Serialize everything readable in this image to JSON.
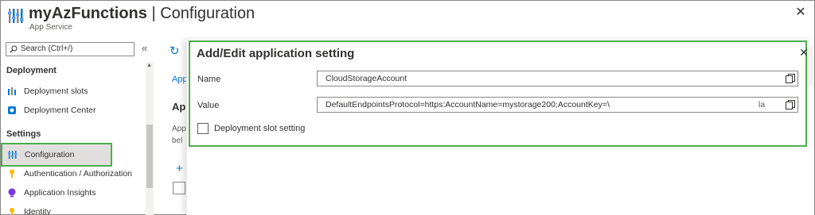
{
  "header": {
    "app_name": "myAzFunctions",
    "separator": " | ",
    "page_title": "Configuration",
    "subtitle": "App Service"
  },
  "sidebar": {
    "search_placeholder": "Search (Ctrl+/)",
    "collapse_glyph": "«",
    "sections": [
      {
        "label": "Deployment"
      },
      {
        "label": "Settings"
      }
    ],
    "items": [
      {
        "label": "Deployment slots",
        "icon": "deployment-slots-icon"
      },
      {
        "label": "Deployment Center",
        "icon": "deployment-center-icon"
      },
      {
        "label": "Configuration",
        "icon": "configuration-icon",
        "active": true
      },
      {
        "label": "Authentication / Authorization",
        "icon": "key-icon"
      },
      {
        "label": "Application Insights",
        "icon": "application-insights-icon"
      },
      {
        "label": "Identity",
        "icon": "identity-icon"
      }
    ]
  },
  "background": {
    "tab_label": "Appl",
    "heading": "Ap",
    "desc_line1": "App",
    "desc_line2": "bel"
  },
  "dialog": {
    "title": "Add/Edit application setting",
    "name_label": "Name",
    "name_value": "CloudStorageAccount",
    "value_label": "Value",
    "value_value": "DefaultEndpointsProtocol=https:AccountName=mystorage200;AccountKey=\\",
    "value_tail": "la",
    "slot_setting_label": "Deployment slot setting",
    "slot_setting_checked": false
  },
  "colors": {
    "accent": "#0078d4",
    "highlight_outline": "#4cae4c",
    "selected_bg": "#e1dfdd"
  }
}
